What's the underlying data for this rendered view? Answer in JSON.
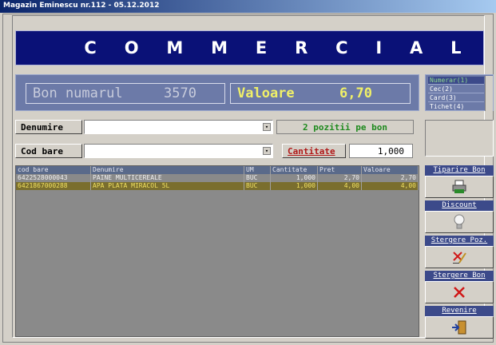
{
  "window": {
    "title": "Magazin Eminescu nr.112 - 05.12.2012"
  },
  "banner": {
    "letters": [
      "C",
      "O",
      "M",
      "M",
      "E",
      "R",
      "C",
      "I",
      "A",
      "L"
    ]
  },
  "bon": {
    "label": "Bon numarul",
    "number": "3570",
    "value_label": "Valoare",
    "value": "6,70"
  },
  "payment_methods": [
    {
      "label": "Numerar(1)",
      "selected": true
    },
    {
      "label": "Cec(2)",
      "selected": false
    },
    {
      "label": "Card(3)",
      "selected": false
    },
    {
      "label": "Tichet(4)",
      "selected": false
    }
  ],
  "fields": {
    "denumire_label": "Denumire",
    "denumire_value": "",
    "cod_bare_label": "Cod bare",
    "cod_bare_value": "",
    "positions_info": "2 pozitii pe bon",
    "cantitate_label": "Cantitate",
    "cantitate_value": "1,000"
  },
  "table": {
    "columns": [
      "cod bare",
      "Denumire",
      "UM",
      "Cantitate",
      "Pret",
      "Valoare"
    ],
    "rows": [
      [
        "6422528000043",
        "PAINE MULTICEREALE",
        "BUC",
        "1,000",
        "2,70",
        "2,70"
      ],
      [
        "6421867000288",
        "APA PLATA MIRACOL 5L",
        "BUC",
        "1,000",
        "4,00",
        "4,00"
      ]
    ]
  },
  "actions": [
    {
      "label": "Tiparire Bon",
      "icon": "printer-icon"
    },
    {
      "label": "Discount",
      "icon": "lightbulb-icon"
    },
    {
      "label": "Stergere Poz.",
      "icon": "delete-position-icon"
    },
    {
      "label": "Stergere Bon",
      "icon": "delete-icon"
    },
    {
      "label": "Revenire",
      "icon": "exit-door-icon"
    }
  ],
  "colors": {
    "banner": "#0a1177",
    "info_bar": "#6c7aa8",
    "selected_row": "#7a6e2e",
    "positions_text": "#1e8a1e"
  }
}
